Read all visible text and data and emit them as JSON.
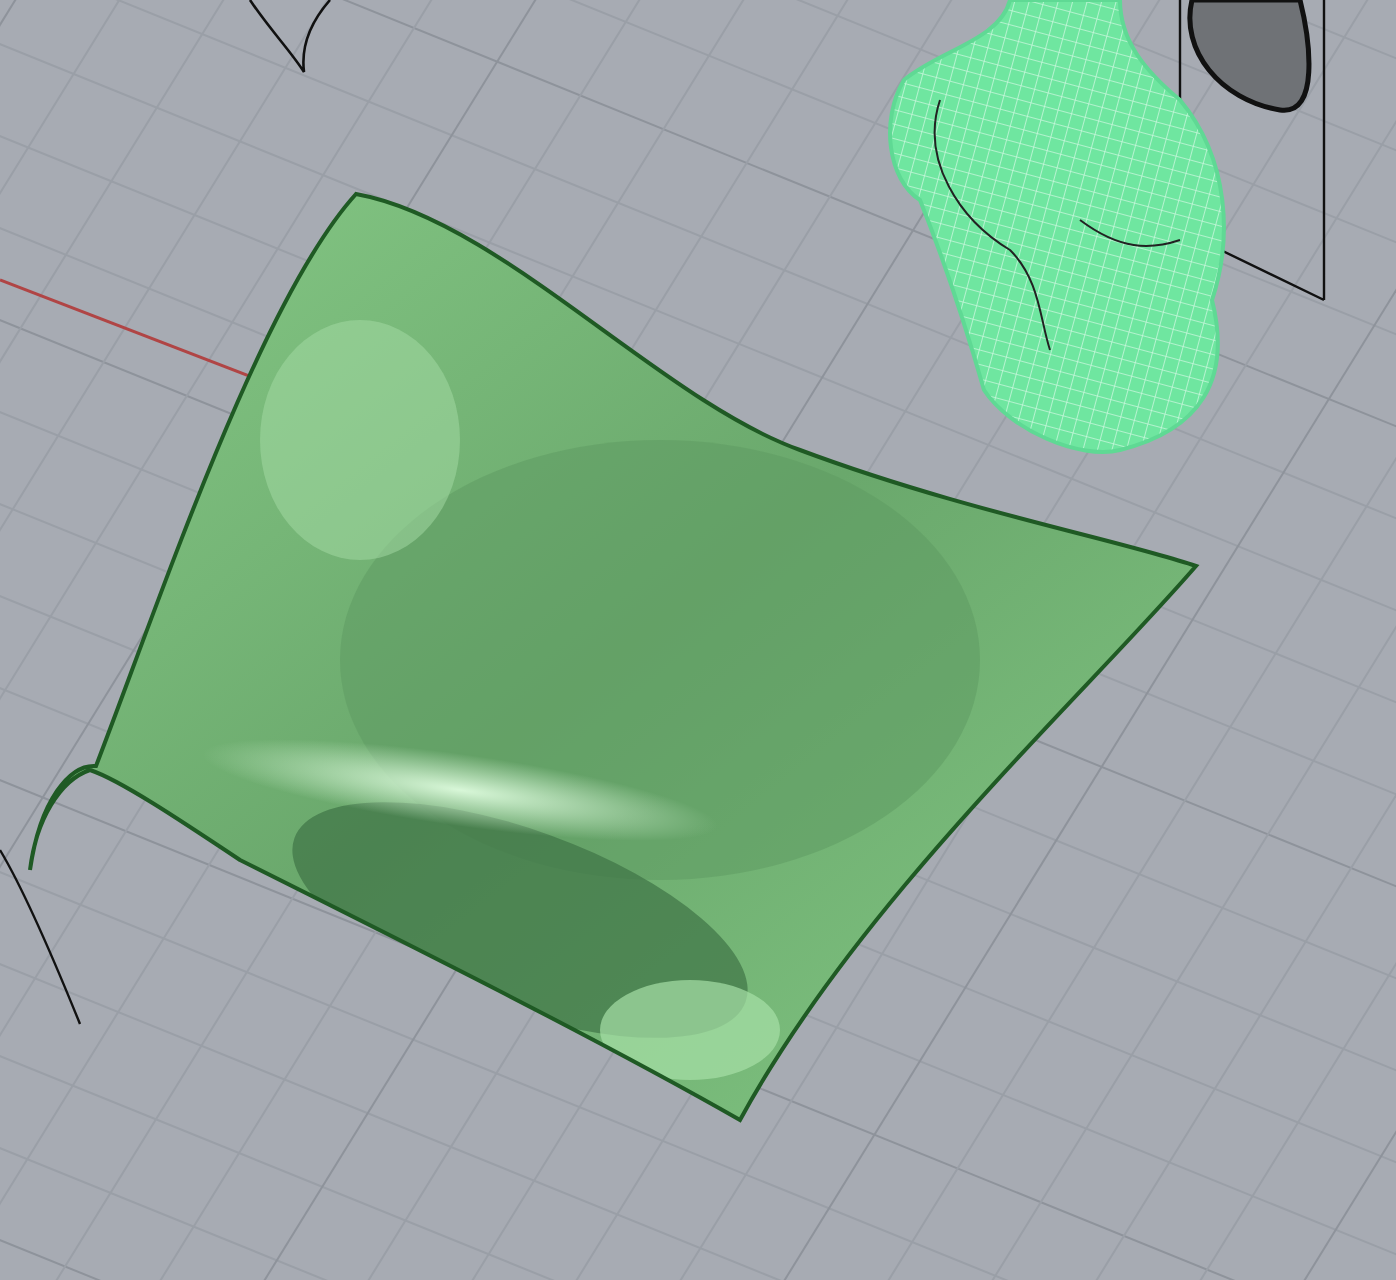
{
  "viewport": {
    "objects": [
      {
        "kind": "grid"
      },
      {
        "kind": "axis"
      },
      {
        "kind": "frame"
      },
      {
        "kind": "curve"
      },
      {
        "kind": "mesh"
      },
      {
        "kind": "surface"
      }
    ]
  }
}
